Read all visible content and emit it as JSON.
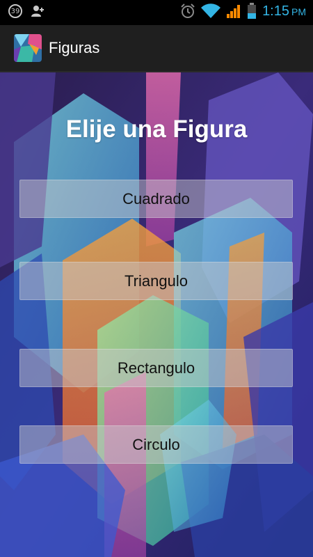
{
  "status_bar": {
    "notification_count": "39",
    "time": "1:15",
    "ampm": "PM"
  },
  "app_bar": {
    "title": "Figuras"
  },
  "main": {
    "heading": "Elije una Figura",
    "buttons": [
      {
        "label": "Cuadrado"
      },
      {
        "label": "Triangulo"
      },
      {
        "label": "Rectangulo"
      },
      {
        "label": "Circulo"
      }
    ]
  },
  "colors": {
    "status_accent": "#33b5e5",
    "action_bar": "#1f1f1f",
    "button_fill": "rgba(200,200,205,0.48)"
  },
  "icons": [
    "notification-count-icon",
    "add-contact-icon",
    "alarm-icon",
    "wifi-icon",
    "signal-icon",
    "battery-icon",
    "app-icon"
  ]
}
